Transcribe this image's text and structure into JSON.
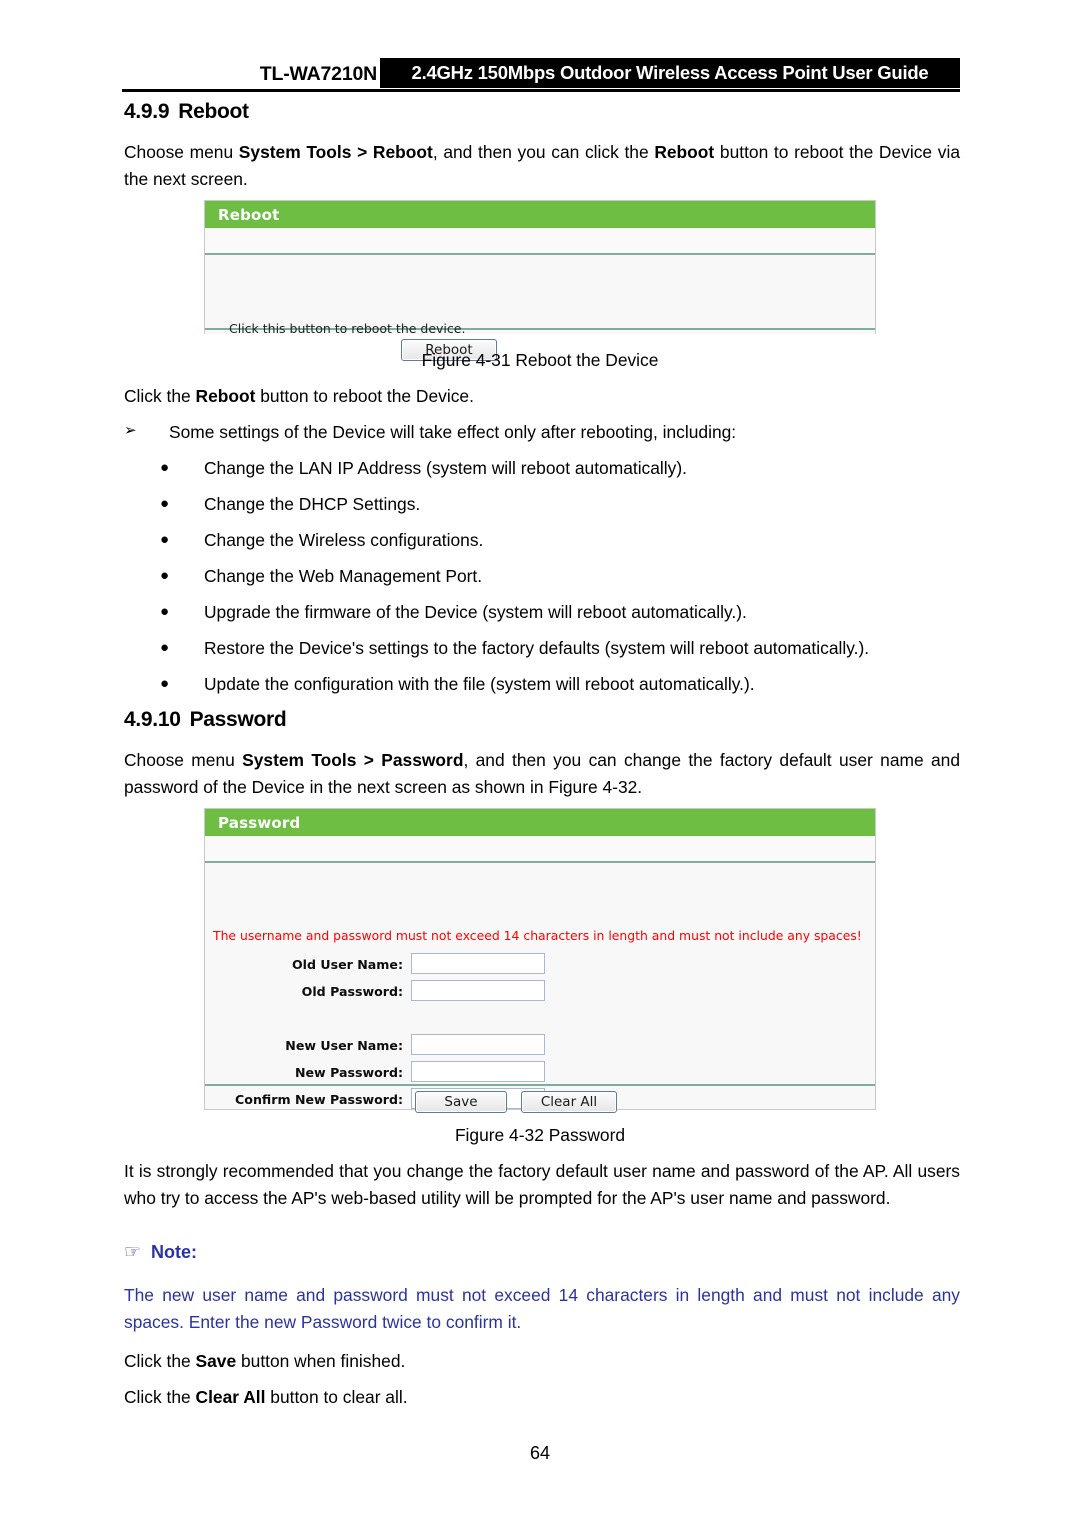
{
  "header": {
    "model": "TL-WA7210N",
    "title": "2.4GHz 150Mbps Outdoor Wireless Access Point User Guide"
  },
  "reboot_section": {
    "number": "4.9.9",
    "heading": "Reboot",
    "intro_1": "Choose menu ",
    "intro_menu": "System Tools > Reboot",
    "intro_2": ", and then you can click the ",
    "intro_bold_btn": "Reboot",
    "intro_3": " button to reboot the Device via the next screen.",
    "caption": "Figure 4-31 Reboot the Device",
    "after_1": "Click the ",
    "after_bold": "Reboot",
    "after_2": " button to reboot the Device.",
    "arrow_item": "Some settings of the Device will take effect only after rebooting, including:",
    "bullets": [
      "Change the LAN IP Address (system will reboot automatically).",
      "Change the DHCP Settings.",
      "Change the Wireless configurations.",
      "Change the Web Management Port.",
      "Upgrade the firmware of the Device (system will reboot automatically.).",
      "Restore the Device's settings to the factory defaults (system will reboot automatically.).",
      "Update the configuration with the file (system will reboot automatically.)."
    ],
    "arrow_glyph": "➢",
    "bullet_glyph": "●"
  },
  "reboot_screen": {
    "panel_title": "Reboot",
    "hint": "Click this button to reboot the device.",
    "button_label": "Reboot",
    "header_color": "#6FBE44",
    "separator_color": "#7EAE9B"
  },
  "password_section": {
    "number": "4.9.10",
    "heading": "Password",
    "intro_1": "Choose menu ",
    "intro_menu": "System Tools > Password",
    "intro_2": ", and then you can change the factory default user name and password of the Device in the next screen as shown in Figure 4-32.",
    "caption": "Figure 4-32 Password",
    "recommend": "It is strongly recommended that you change the factory default user name and password of the AP. All users who try to access the AP's web-based utility will be prompted for the AP's user name and password.",
    "note_label": "Note:",
    "note_icon": "☞",
    "note_text": "The new user name and password must not exceed 14 characters in length and must not include any spaces. Enter the new Password twice to confirm it.",
    "note_color": "#2B33A0",
    "click_save_1": "Click the ",
    "click_save_bold": "Save",
    "click_save_2": " button when finished.",
    "click_clear_1": "Click the ",
    "click_clear_bold": "Clear All",
    "click_clear_2": " button to clear all."
  },
  "password_screen": {
    "panel_title": "Password",
    "warning": "The username and password must not exceed 14 characters in length and must not include any spaces!",
    "warning_color": "#FF0000",
    "fields": [
      {
        "label": "Old User Name:",
        "value": ""
      },
      {
        "label": "Old Password:",
        "value": ""
      },
      {
        "label": "New User Name:",
        "value": ""
      },
      {
        "label": "New Password:",
        "value": ""
      },
      {
        "label": "Confirm New Password:",
        "value": ""
      }
    ],
    "save_label": "Save",
    "clear_label": "Clear All"
  },
  "footer": {
    "page_number": "64"
  }
}
